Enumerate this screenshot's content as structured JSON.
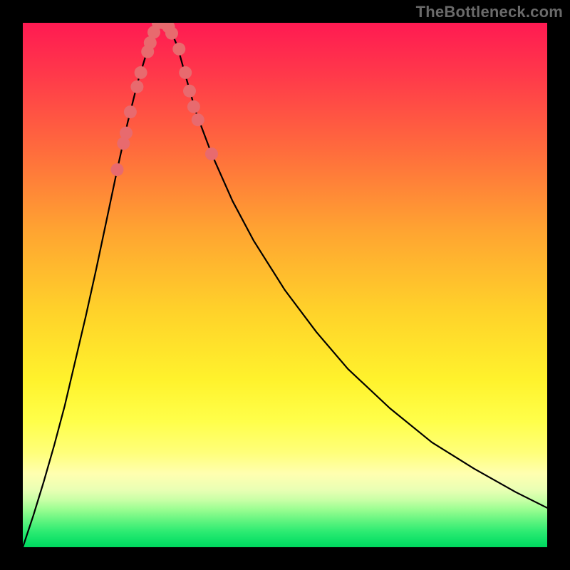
{
  "watermark": "TheBottleneck.com",
  "chart_data": {
    "type": "line",
    "title": "",
    "xlabel": "",
    "ylabel": "",
    "xlim": [
      0,
      1
    ],
    "ylim": [
      0,
      1
    ],
    "grid": false,
    "series": [
      {
        "name": "curve",
        "x": [
          0.0,
          0.02,
          0.04,
          0.06,
          0.08,
          0.1,
          0.12,
          0.14,
          0.16,
          0.18,
          0.2,
          0.22,
          0.24,
          0.258,
          0.268,
          0.28,
          0.295,
          0.31,
          0.33,
          0.36,
          0.4,
          0.44,
          0.5,
          0.56,
          0.62,
          0.7,
          0.78,
          0.86,
          0.94,
          1.0
        ],
        "y": [
          0.0,
          0.06,
          0.125,
          0.195,
          0.27,
          0.355,
          0.44,
          0.53,
          0.625,
          0.72,
          0.81,
          0.89,
          0.955,
          1.0,
          1.0,
          0.99,
          0.955,
          0.9,
          0.83,
          0.75,
          0.66,
          0.585,
          0.49,
          0.41,
          0.34,
          0.265,
          0.2,
          0.15,
          0.105,
          0.075
        ]
      }
    ],
    "points": [
      {
        "x": 0.18,
        "y": 0.72
      },
      {
        "x": 0.192,
        "y": 0.77
      },
      {
        "x": 0.197,
        "y": 0.79
      },
      {
        "x": 0.205,
        "y": 0.83
      },
      {
        "x": 0.218,
        "y": 0.878
      },
      {
        "x": 0.225,
        "y": 0.905
      },
      {
        "x": 0.238,
        "y": 0.945
      },
      {
        "x": 0.243,
        "y": 0.962
      },
      {
        "x": 0.25,
        "y": 0.982
      },
      {
        "x": 0.258,
        "y": 1.0
      },
      {
        "x": 0.268,
        "y": 1.0
      },
      {
        "x": 0.278,
        "y": 0.992
      },
      {
        "x": 0.284,
        "y": 0.98
      },
      {
        "x": 0.298,
        "y": 0.95
      },
      {
        "x": 0.31,
        "y": 0.905
      },
      {
        "x": 0.318,
        "y": 0.87
      },
      {
        "x": 0.326,
        "y": 0.84
      },
      {
        "x": 0.334,
        "y": 0.815
      },
      {
        "x": 0.36,
        "y": 0.75
      }
    ],
    "background_gradient": {
      "direction": "vertical",
      "stops": [
        {
          "pos": 0.0,
          "color": "#ff1a52"
        },
        {
          "pos": 0.45,
          "color": "#ffb22e"
        },
        {
          "pos": 0.78,
          "color": "#ffff55"
        },
        {
          "pos": 1.0,
          "color": "#00d85e"
        }
      ]
    }
  }
}
